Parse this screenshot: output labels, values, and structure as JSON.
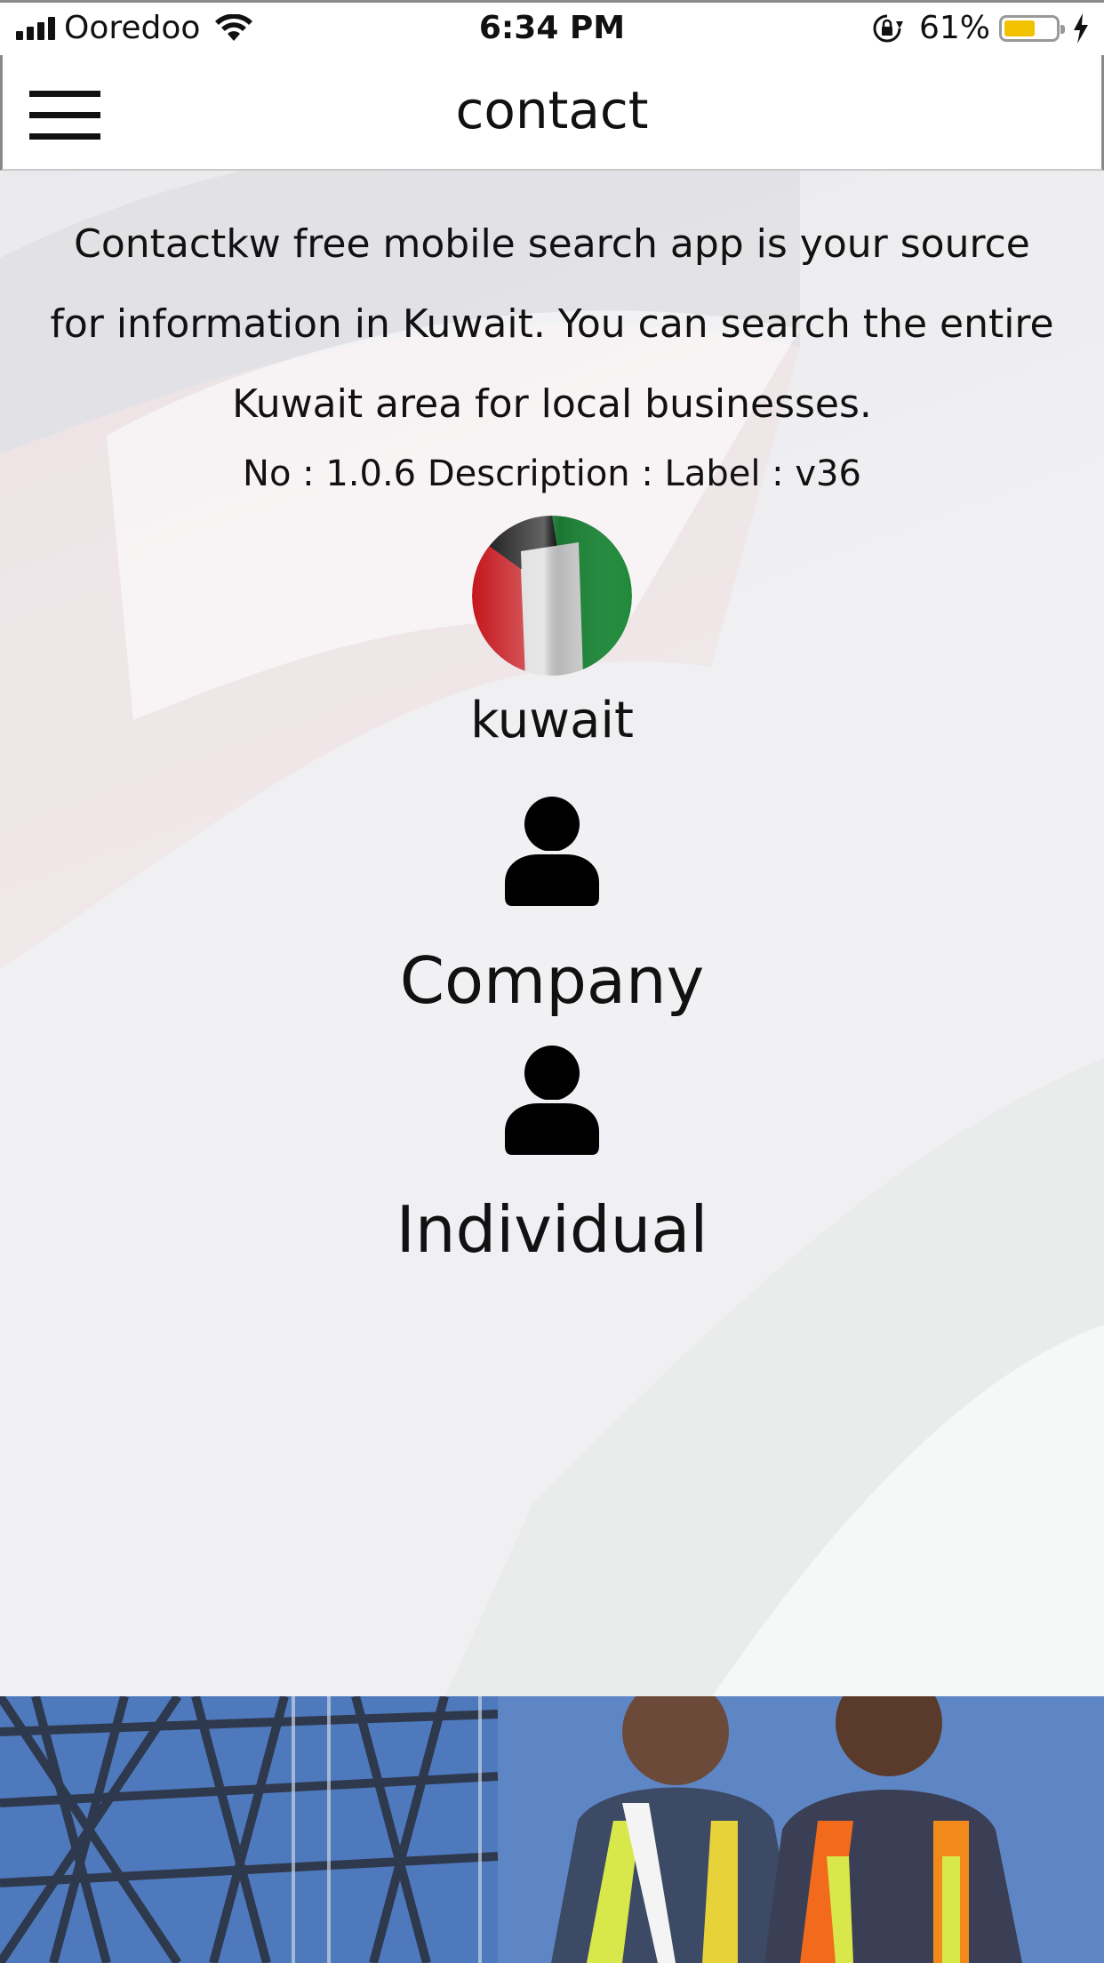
{
  "status_bar": {
    "carrier": "Ooredoo",
    "time": "6:34 PM",
    "battery_percent_text": "61%",
    "battery_level": 0.61,
    "battery_color": "#f2c200"
  },
  "header": {
    "title": "contact",
    "menu_icon": "hamburger-menu-icon"
  },
  "main": {
    "description": "Contactkw free mobile search app is your source for information in Kuwait. You can search the entire Kuwait area for local businesses.",
    "version_info": "No : 1.0.6 Description :  Label : v36",
    "country": {
      "label": "kuwait",
      "flag_colors": [
        "#000000",
        "#ffffff",
        "#1f8a3a",
        "#c4161c"
      ]
    },
    "options": [
      {
        "label": "Company",
        "icon": "person-icon"
      },
      {
        "label": "Individual",
        "icon": "person-icon"
      }
    ]
  },
  "banner": {
    "image": "workers-construction-photo"
  }
}
